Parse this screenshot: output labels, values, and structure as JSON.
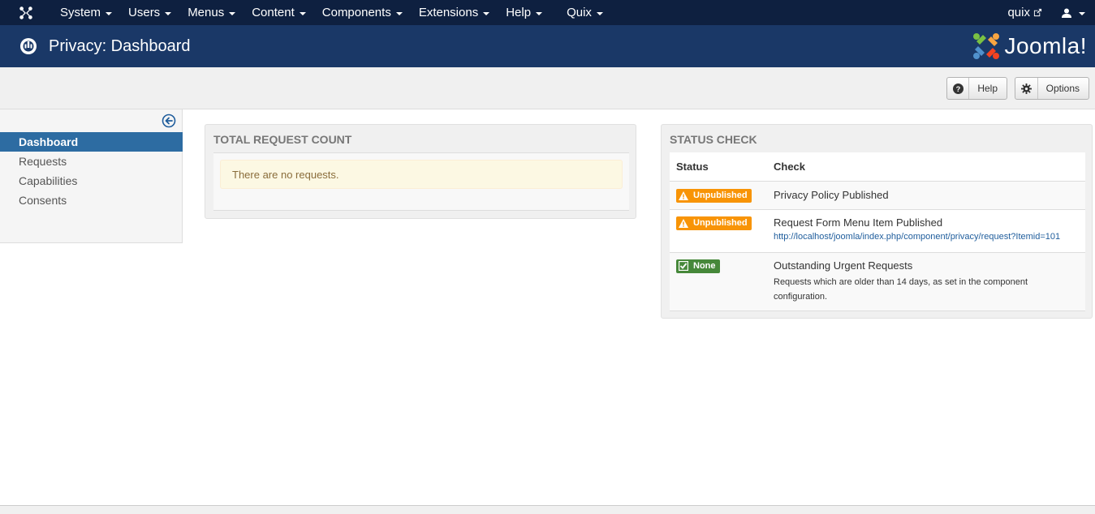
{
  "navbar": {
    "menu": [
      {
        "label": "System",
        "name": "system"
      },
      {
        "label": "Users",
        "name": "users"
      },
      {
        "label": "Menus",
        "name": "menus"
      },
      {
        "label": "Content",
        "name": "content"
      },
      {
        "label": "Components",
        "name": "components"
      },
      {
        "label": "Extensions",
        "name": "extensions"
      },
      {
        "label": "Help",
        "name": "help"
      },
      {
        "label": "Quix",
        "name": "quix"
      }
    ],
    "site_link": "quix"
  },
  "header": {
    "title": "Privacy: Dashboard",
    "brand": "Joomla!"
  },
  "toolbar": {
    "help_label": "Help",
    "options_label": "Options"
  },
  "sidebar": {
    "items": [
      {
        "label": "Dashboard",
        "active": true
      },
      {
        "label": "Requests",
        "active": false
      },
      {
        "label": "Capabilities",
        "active": false
      },
      {
        "label": "Consents",
        "active": false
      }
    ]
  },
  "request_panel": {
    "title": "Total Request Count",
    "message": "There are no requests."
  },
  "status_panel": {
    "title": "Status Check",
    "col_status": "Status",
    "col_check": "Check",
    "rows": [
      {
        "status": "Unpublished",
        "type": "warning",
        "check": "Privacy Policy Published",
        "detail": ""
      },
      {
        "status": "Unpublished",
        "type": "warning",
        "check": "Request Form Menu Item Published",
        "detail": "http://localhost/joomla/index.php/component/privacy/request?Itemid=101"
      },
      {
        "status": "None",
        "type": "ok",
        "check": "Outstanding Urgent Requests",
        "detail": "Requests which are older than 14 days, as set in the component configuration."
      }
    ]
  },
  "colors": {
    "navbar": "#0e2040",
    "titlebar": "#1a3867",
    "active_item": "#2d6ca2",
    "warning": "#f89406",
    "success": "#46883a"
  }
}
